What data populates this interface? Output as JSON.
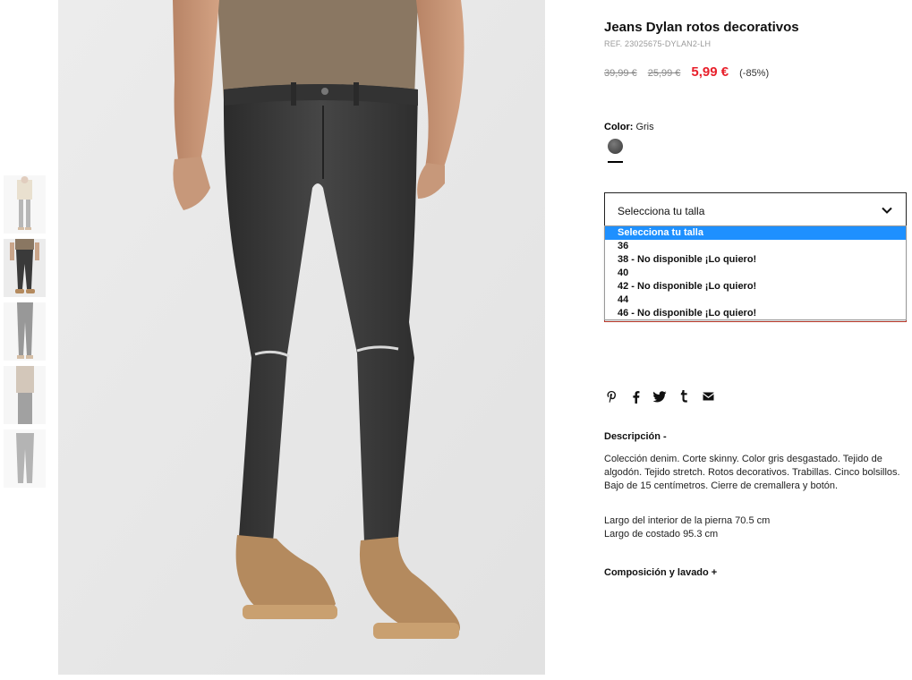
{
  "product": {
    "title": "Jeans Dylan rotos decorativos",
    "ref": "REF. 23025675-DYLAN2-LH",
    "prices": {
      "original": "39,99 €",
      "previous": "25,99 €",
      "current": "5,99 €",
      "discount": "(-85%)"
    },
    "color": {
      "label": "Color:",
      "value": "Gris",
      "swatch_hex": "#5a5a5a"
    }
  },
  "size_select": {
    "value": "Selecciona tu talla",
    "options": [
      "Selecciona tu talla",
      "36",
      "38 - No disponible ¡Lo quiero!",
      "40",
      "42 - No disponible ¡Lo quiero!",
      "44",
      "46 - No disponible ¡Lo quiero!"
    ],
    "selected_index": 0
  },
  "share": [
    "pinterest-icon",
    "facebook-icon",
    "twitter-icon",
    "tumblr-icon",
    "email-icon"
  ],
  "description": {
    "title": "Descripción  -",
    "text": "Colección denim. Corte skinny. Color gris desgastado. Tejido de algodón. Tejido stretch. Rotos decorativos. Trabillas. Cinco bolsillos. Bajo de 15 centímetros. Cierre de cremallera y botón.",
    "inseam": "Largo del interior de la pierna 70.5 cm",
    "side": "Largo de costado 95.3 cm"
  },
  "composition": {
    "title": "Composición y lavado  +"
  },
  "colors": {
    "sale_red": "#e8202b",
    "select_highlight": "#1e90ff",
    "denim": "#3a3a3a",
    "shoe": "#b48a5e",
    "tshirt": "#8a7762"
  }
}
